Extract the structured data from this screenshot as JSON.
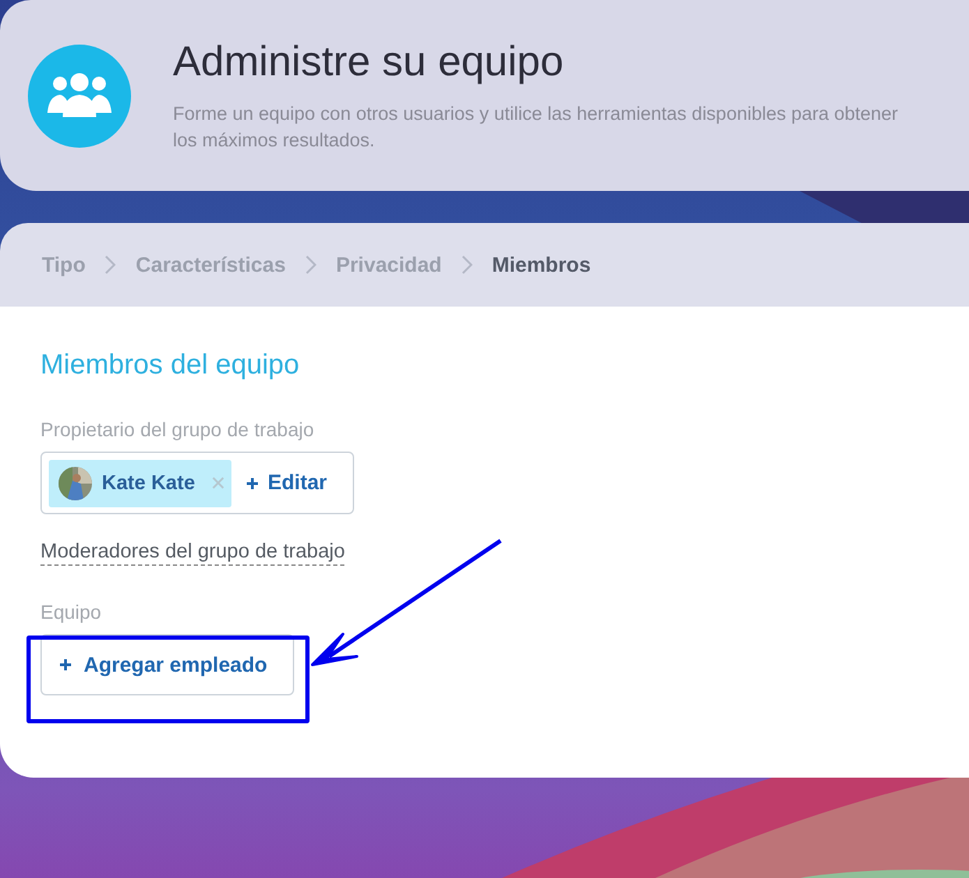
{
  "header": {
    "title": "Administre su equipo",
    "subtitle": "Forme un equipo con otros usuarios y utilice las herramientas disponibles para obtener los máximos resultados."
  },
  "breadcrumb": [
    {
      "label": "Tipo",
      "selected": false
    },
    {
      "label": "Características",
      "selected": false
    },
    {
      "label": "Privacidad",
      "selected": false
    },
    {
      "label": "Miembros",
      "selected": true
    }
  ],
  "section_title": "Miembros del equipo",
  "owner": {
    "label": "Propietario del grupo de trabajo",
    "name": "Kate Kate",
    "edit_button": "Editar"
  },
  "moderators_link": "Moderadores del grupo de trabajo",
  "team": {
    "label": "Equipo",
    "add_button": "Agregar empleado"
  }
}
